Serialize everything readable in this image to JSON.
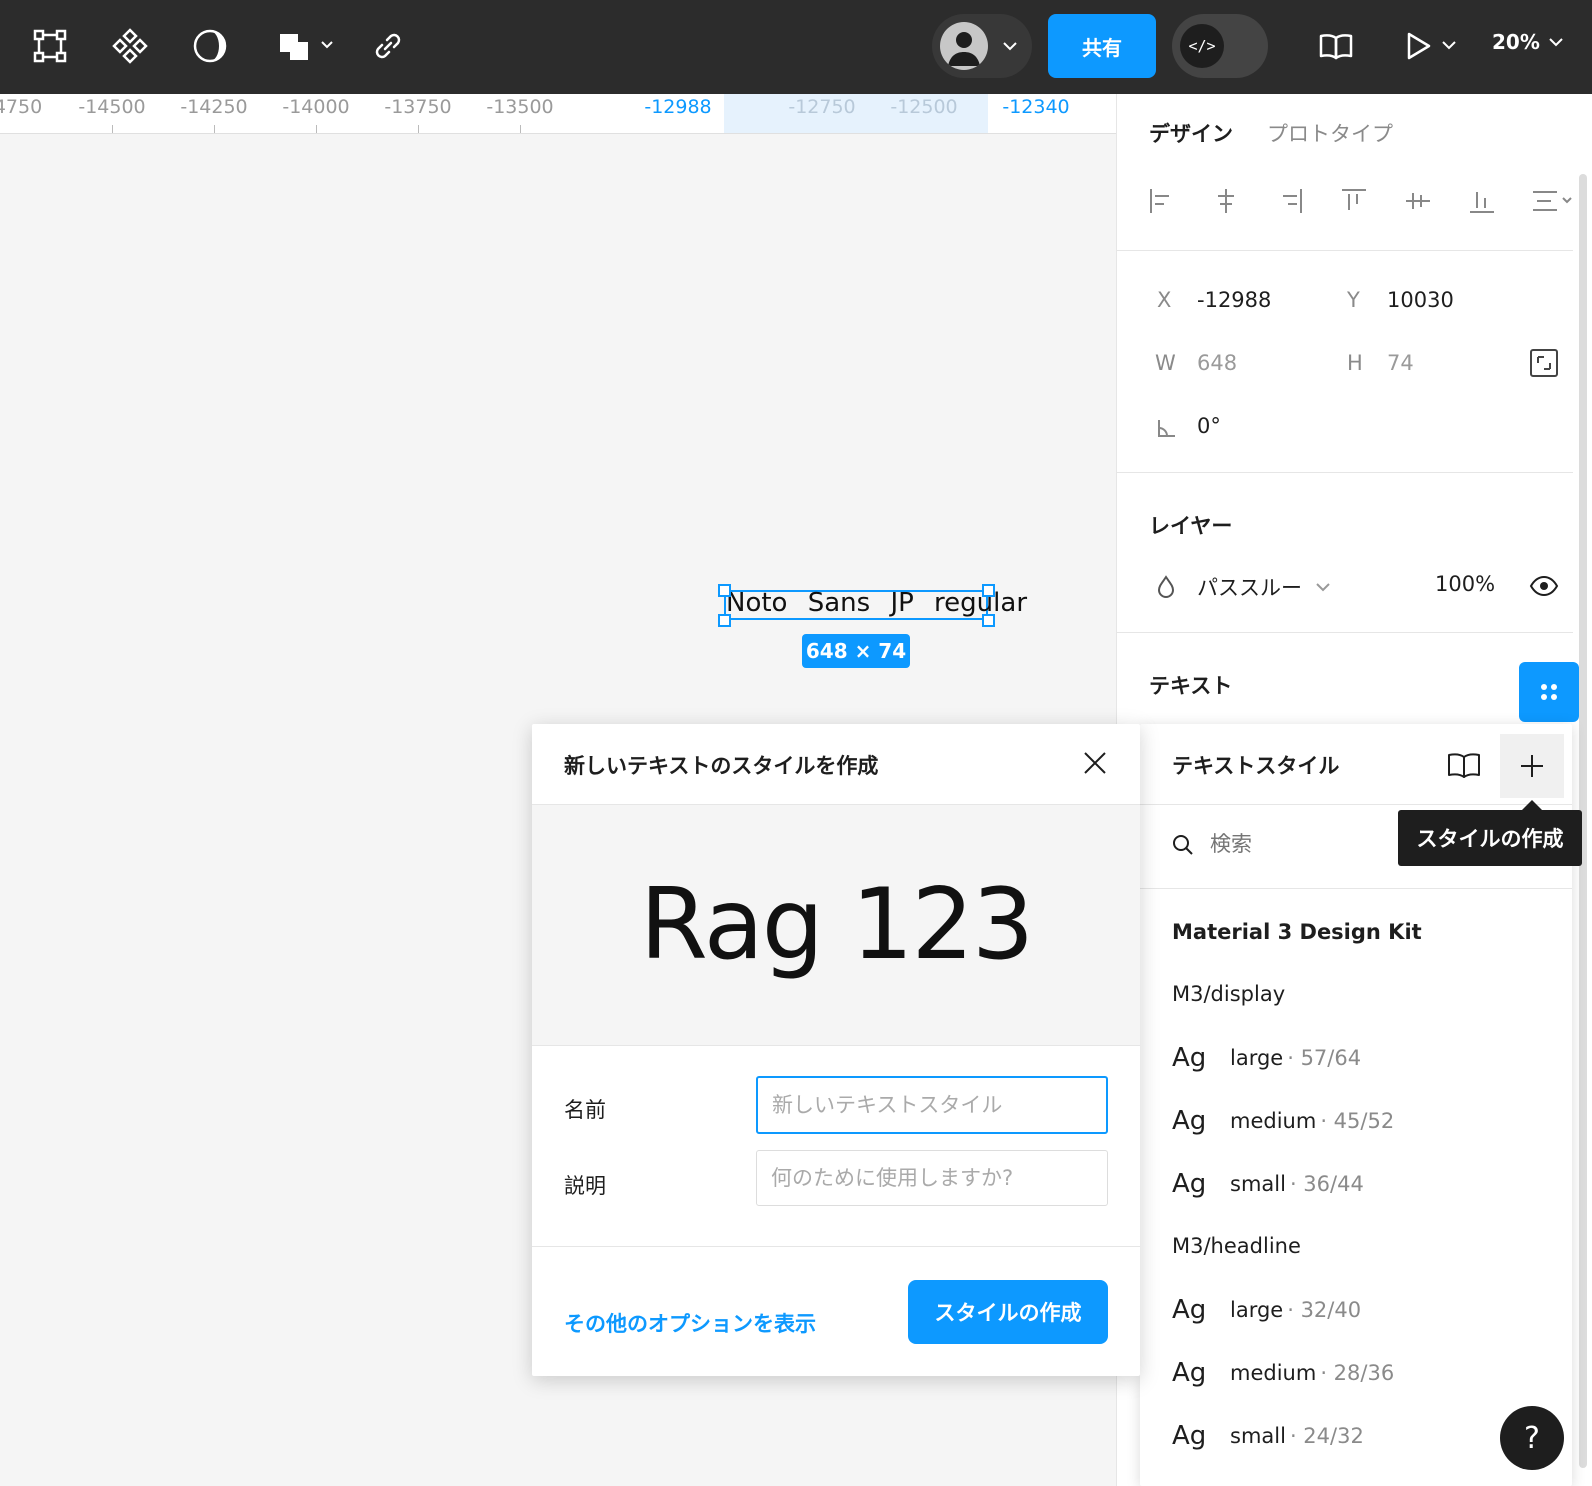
{
  "toolbar": {
    "share_label": "共有",
    "dev_mode_label": "</>",
    "zoom": "20%"
  },
  "ruler": {
    "ticks": [
      "4750",
      "-14500",
      "-14250",
      "-14000",
      "-13750",
      "-13500",
      "-12750",
      "-12500"
    ],
    "selection_start": "-12988",
    "selection_end": "-12340"
  },
  "canvas": {
    "text_content": "Noto Sans JP regular",
    "size_badge": "648 × 74"
  },
  "panel": {
    "tab_design": "デザイン",
    "tab_prototype": "プロトタイプ",
    "x_label": "X",
    "x_value": "-12988",
    "y_label": "Y",
    "y_value": "10030",
    "w_label": "W",
    "w_value": "648",
    "h_label": "H",
    "h_value": "74",
    "rotation_value": "0°",
    "layer_title": "レイヤー",
    "blend_mode": "パススルー",
    "opacity": "100%",
    "text_title": "テキスト"
  },
  "text_styles": {
    "title": "テキストスタイル",
    "search_placeholder": "検索",
    "tooltip": "スタイルの作成",
    "library": "Material 3 Design Kit",
    "sample": "Ag",
    "groups": [
      {
        "name": "M3/display",
        "items": [
          {
            "name": "large",
            "meta": "· 57/64"
          },
          {
            "name": "medium",
            "meta": "· 45/52"
          },
          {
            "name": "small",
            "meta": "· 36/44"
          }
        ]
      },
      {
        "name": "M3/headline",
        "items": [
          {
            "name": "large",
            "meta": "· 32/40"
          },
          {
            "name": "medium",
            "meta": "· 28/36"
          },
          {
            "name": "small",
            "meta": "· 24/32"
          }
        ]
      }
    ]
  },
  "dialog": {
    "title": "新しいテキストのスタイルを作成",
    "preview": "Rag 123",
    "name_label": "名前",
    "name_placeholder": "新しいテキストスタイル",
    "desc_label": "説明",
    "desc_placeholder": "何のために使用しますか?",
    "more_options": "その他のオプションを表示",
    "create_button": "スタイルの作成"
  },
  "help_label": "?",
  "colors": {
    "accent": "#0d99ff",
    "toolbar_bg": "#2c2c2c",
    "canvas_bg": "#f5f5f5"
  }
}
